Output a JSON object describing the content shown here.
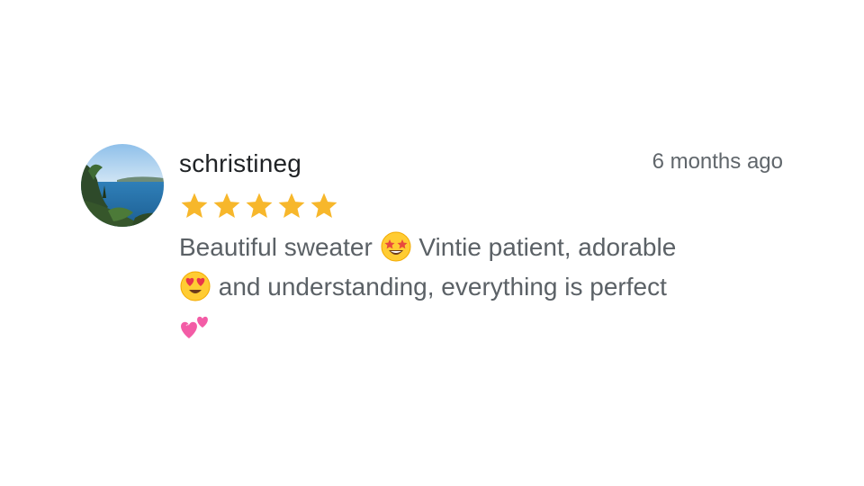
{
  "review": {
    "username": "schristineg",
    "time_ago": "6 months ago",
    "rating": 5,
    "rating_max": 5,
    "text_part1": "Beautiful sweater",
    "emoji1": "star-struck-emoji",
    "text_part2": "Vintie patient, adorable",
    "emoji2": "heart-eyes-emoji",
    "text_part3": "and understanding, everything is perfect",
    "emoji3": "two-hearts-emoji"
  },
  "colors": {
    "star": "#F7B72B",
    "username": "#1F2225",
    "body_text": "#5B6166",
    "time_text": "#60666B"
  }
}
